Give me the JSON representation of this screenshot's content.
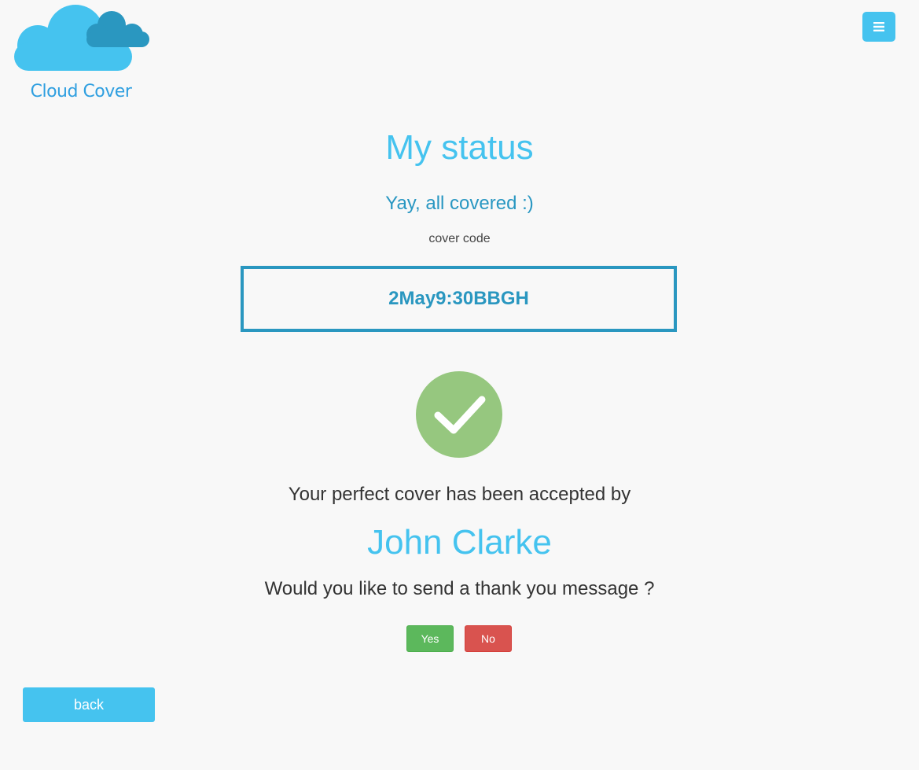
{
  "header": {
    "logo_text": "Cloud Cover",
    "logo_icon": "cloud-icon",
    "menu_icon": "hamburger-menu-icon"
  },
  "status": {
    "title": "My status",
    "subtitle": "Yay, all covered :)",
    "code_label": "cover code",
    "code_value": "2May9:30BBGH",
    "status_icon": "checkmark-circle-icon",
    "accepted_text": "Your perfect cover has been accepted by",
    "person_name": "John Clarke",
    "question": "Would you like to send a thank you message ?",
    "yes_label": "Yes",
    "no_label": "No"
  },
  "footer": {
    "back_label": "back"
  },
  "colors": {
    "accent": "#45c3ef",
    "accent_dark": "#2a97c0",
    "success": "#5cb85c",
    "danger": "#d9534f",
    "check_circle": "#96c77f",
    "background": "#f8f8f8",
    "text": "#333333"
  }
}
